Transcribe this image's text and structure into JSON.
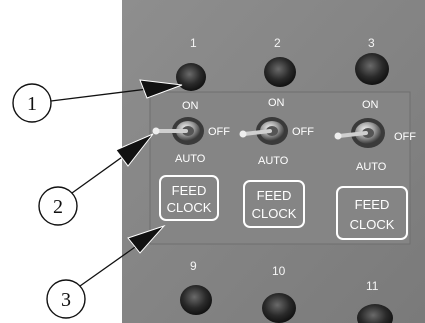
{
  "panel": {
    "top_numbers": [
      "1",
      "2",
      "3"
    ],
    "bottom_numbers": [
      "9",
      "10",
      "11"
    ],
    "switch_on_label": "ON",
    "switch_off_label": "OFF",
    "switch_auto_label": "AUTO",
    "feed_clock_line1": "FEED",
    "feed_clock_line2": "CLOCK"
  },
  "callouts": [
    "1",
    "2",
    "3"
  ]
}
